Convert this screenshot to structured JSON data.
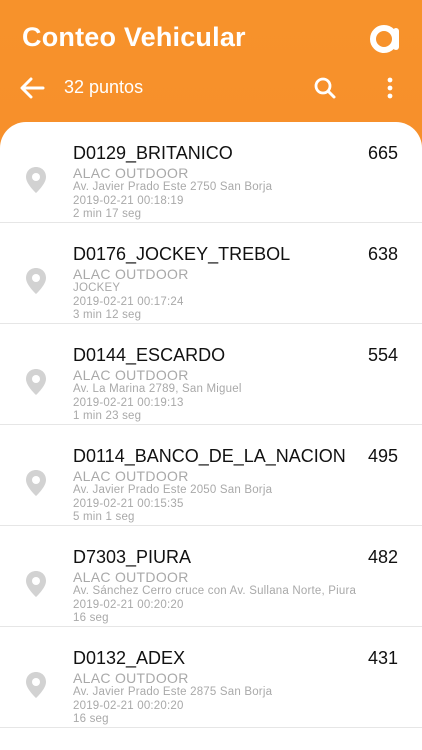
{
  "header": {
    "title": "Conteo Vehicular",
    "logo_icon": "brand-a-logo"
  },
  "toolbar": {
    "back_icon": "arrow-left-icon",
    "subtitle": "32 puntos",
    "search_icon": "search-icon",
    "menu_icon": "more-vertical-icon"
  },
  "colors": {
    "header_bg": "#f6872a",
    "card_bg": "#ffffff",
    "primary_text": "#111111",
    "secondary_text": "#a9a9a9",
    "pin_color": "#d2d2d2"
  },
  "items": [
    {
      "name": "D0129_BRITANICO",
      "count": "665",
      "company": "ALAC OUTDOOR",
      "address": "Av. Javier Prado Este 2750 San Borja",
      "datetime": "2019-02-21 00:18:19",
      "duration": "2 min 17 seg"
    },
    {
      "name": "D0176_JOCKEY_TREBOL",
      "count": "638",
      "company": "ALAC OUTDOOR",
      "address": "JOCKEY",
      "datetime": "2019-02-21 00:17:24",
      "duration": "3 min 12 seg"
    },
    {
      "name": "D0144_ESCARDO",
      "count": "554",
      "company": "ALAC OUTDOOR",
      "address": "Av. La Marina 2789, San Miguel",
      "datetime": "2019-02-21 00:19:13",
      "duration": "1 min 23 seg"
    },
    {
      "name": "D0114_BANCO_DE_LA_NACION",
      "count": "495",
      "company": "ALAC OUTDOOR",
      "address": "Av. Javier Prado Este 2050 San Borja",
      "datetime": "2019-02-21 00:15:35",
      "duration": "5 min 1 seg"
    },
    {
      "name": "D7303_PIURA",
      "count": "482",
      "company": "ALAC OUTDOOR",
      "address": "Av. Sánchez Cerro cruce con Av. Sullana Norte, Piura",
      "datetime": "2019-02-21 00:20:20",
      "duration": "16 seg"
    },
    {
      "name": "D0132_ADEX",
      "count": "431",
      "company": "ALAC OUTDOOR",
      "address": "Av. Javier Prado Este 2875 San Borja",
      "datetime": "2019-02-21 00:20:20",
      "duration": "16 seg"
    }
  ]
}
